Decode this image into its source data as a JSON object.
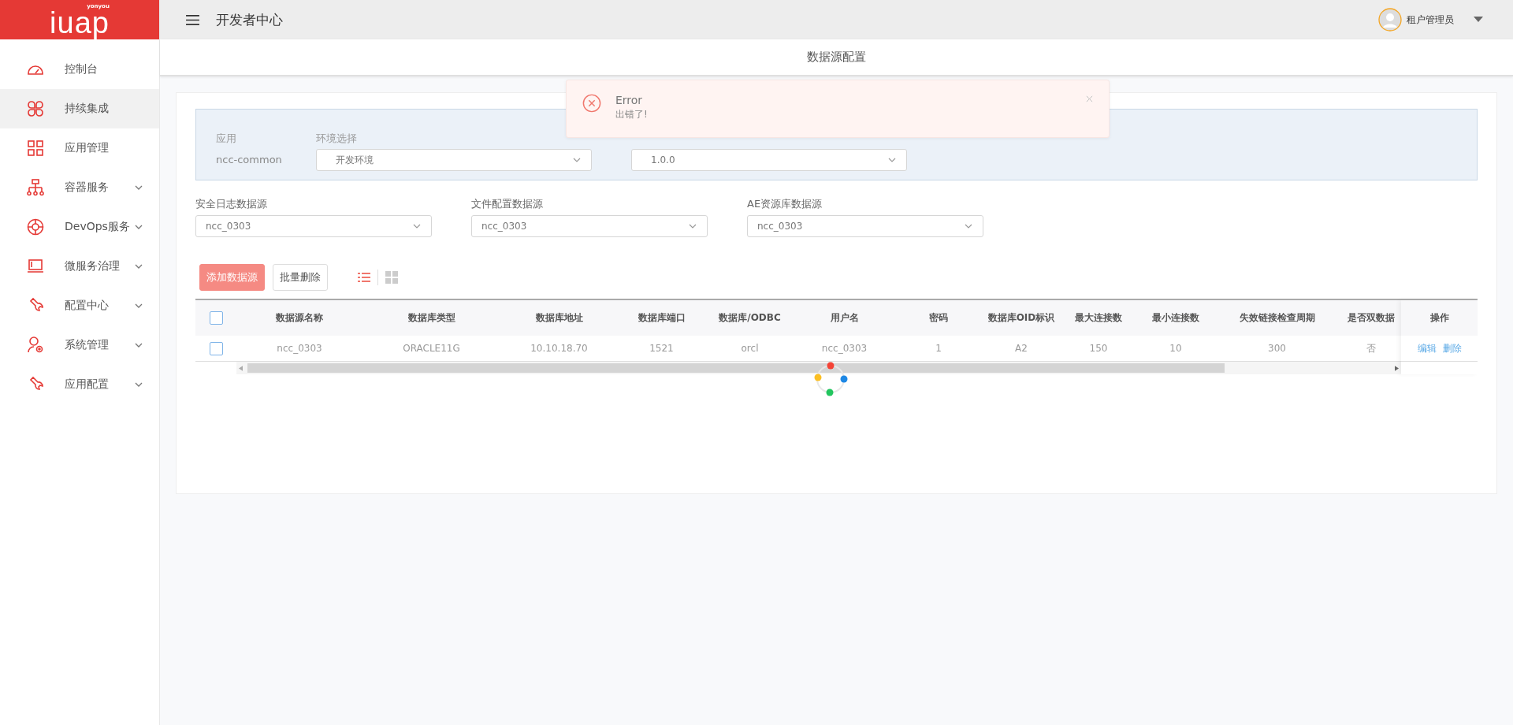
{
  "brand": {
    "logo": "iuap",
    "sublogo": "yonyou"
  },
  "sidebar": {
    "items": [
      {
        "label": "控制台",
        "selected": false,
        "expandable": false
      },
      {
        "label": "持续集成",
        "selected": true,
        "expandable": false
      },
      {
        "label": "应用管理",
        "selected": false,
        "expandable": false
      },
      {
        "label": "容器服务",
        "selected": false,
        "expandable": true
      },
      {
        "label": "DevOps服务",
        "selected": false,
        "expandable": true
      },
      {
        "label": "微服务治理",
        "selected": false,
        "expandable": true
      },
      {
        "label": "配置中心",
        "selected": false,
        "expandable": true
      },
      {
        "label": "系统管理",
        "selected": false,
        "expandable": true
      },
      {
        "label": "应用配置",
        "selected": false,
        "expandable": true
      }
    ]
  },
  "header": {
    "title": "开发者中心",
    "user": "租户管理员"
  },
  "page_title": "数据源配置",
  "toast": {
    "title": "Error",
    "message": "出错了!"
  },
  "app_panel": {
    "app_label": "应用",
    "app_value": "ncc-common",
    "env_label": "环境选择",
    "env_value": "开发环境",
    "version_value": "1.0.0"
  },
  "sources": [
    {
      "label": "安全日志数据源",
      "value": "ncc_0303"
    },
    {
      "label": "文件配置数据源",
      "value": "ncc_0303"
    },
    {
      "label": "AE资源库数据源",
      "value": "ncc_0303"
    }
  ],
  "toolbar": {
    "add": "添加数据源",
    "batch_delete": "批量删除",
    "views": [
      {
        "kind": "list",
        "selected": true
      },
      {
        "kind": "grid",
        "selected": false
      }
    ]
  },
  "table": {
    "columns": [
      "数据源名称",
      "数据库类型",
      "数据库地址",
      "数据库端口",
      "数据库/ODBC",
      "用户名",
      "密码",
      "数据库OID标识",
      "最大连接数",
      "最小连接数",
      "失效链接检查周期",
      "是否双数据"
    ],
    "action_column": "操作",
    "rows": [
      {
        "checked": false,
        "cells": [
          "ncc_0303",
          "ORACLE11G",
          "10.10.18.70",
          "1521",
          "orcl",
          "ncc_0303",
          "1",
          "A2",
          "150",
          "10",
          "300",
          "否"
        ],
        "actions": [
          "编辑",
          "删除"
        ]
      }
    ]
  },
  "all_checked": false,
  "loading": true
}
